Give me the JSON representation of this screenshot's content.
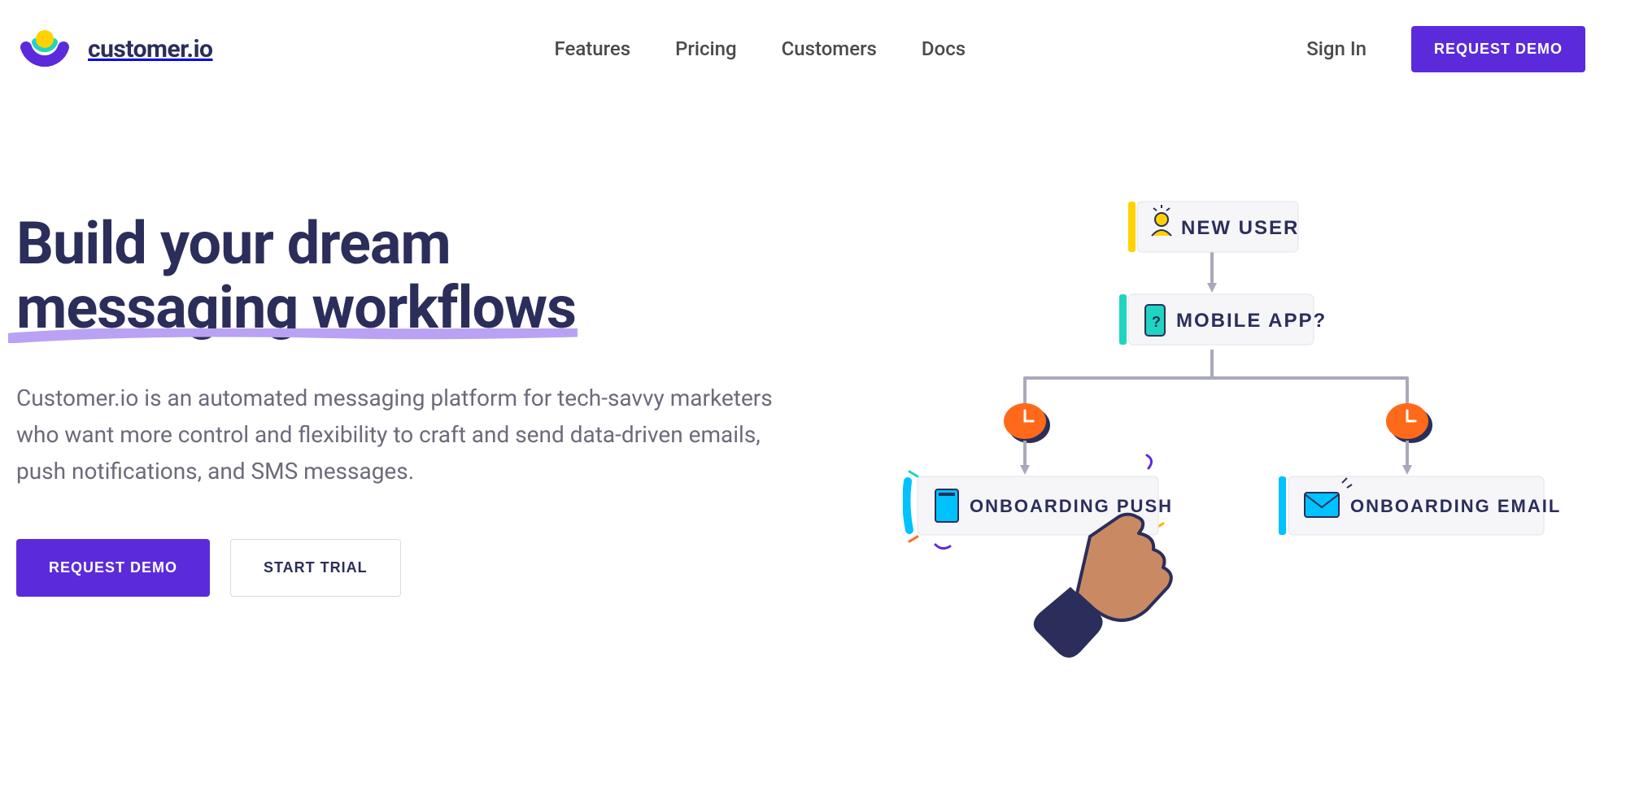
{
  "brand": {
    "wordmark": "customer.io"
  },
  "nav": {
    "items": [
      "Features",
      "Pricing",
      "Customers",
      "Docs"
    ],
    "signin": "Sign In",
    "request_demo": "REQUEST DEMO"
  },
  "hero": {
    "title_line1": "Build your dream",
    "title_line2": "messaging workflows",
    "subtitle": "Customer.io is an automated messaging platform for tech-savvy marketers who want more control and flexibility to craft and send data-driven emails, push notifications, and SMS messages.",
    "cta_primary": "REQUEST DEMO",
    "cta_secondary": "START TRIAL"
  },
  "diagram": {
    "nodes": {
      "new_user": "NEW USER",
      "mobile_app": "MOBILE APP?",
      "onboarding_push": "ONBOARDING PUSH",
      "onboarding_email": "ONBOARDING EMAIL"
    }
  }
}
